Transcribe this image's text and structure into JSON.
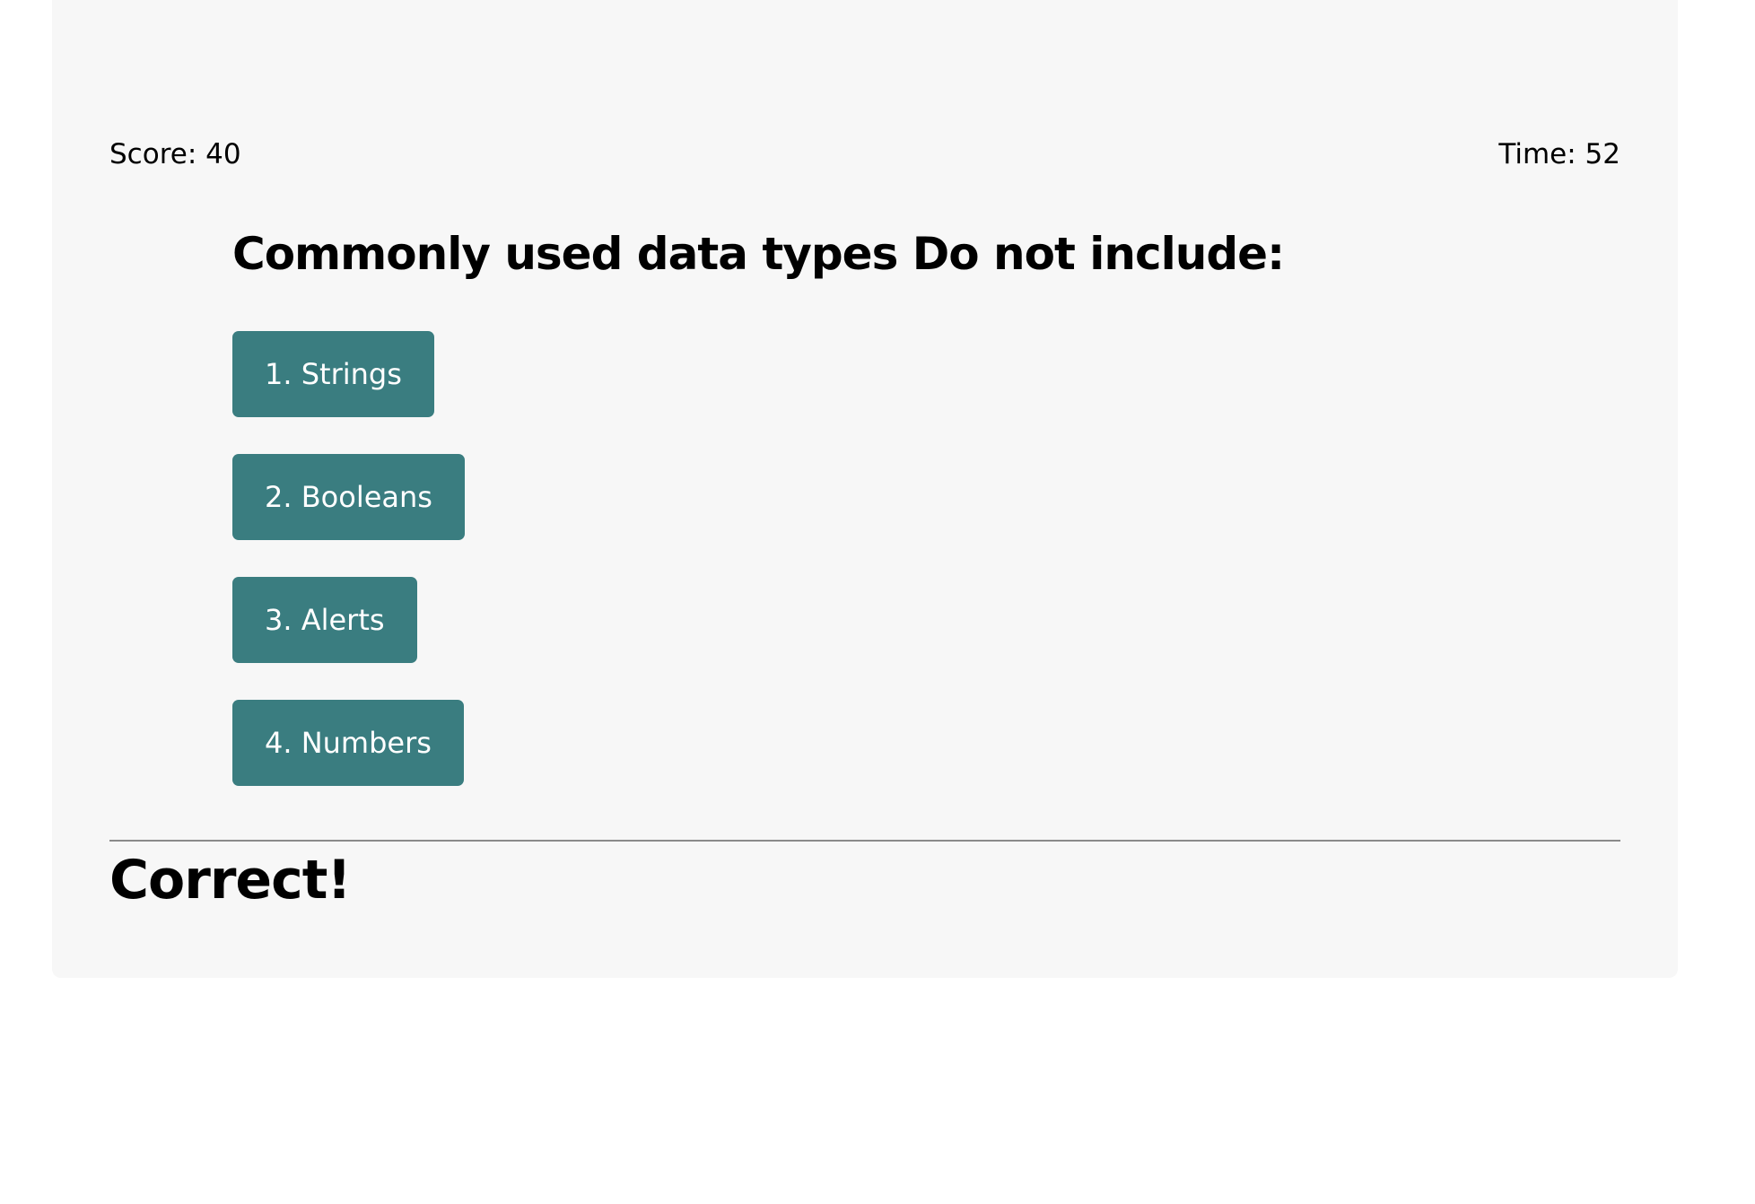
{
  "stats": {
    "score": "Score: 40",
    "time": "Time: 52"
  },
  "question": {
    "title": "Commonly used data types Do not include:",
    "choices": [
      {
        "label": "1. Strings"
      },
      {
        "label": "2. Booleans"
      },
      {
        "label": "3. Alerts"
      },
      {
        "label": "4. Numbers"
      }
    ]
  },
  "feedback": {
    "text": "Correct!"
  },
  "colors": {
    "card_background": "#f7f7f7",
    "button_background": "#3a7d80",
    "button_text": "#ffffff",
    "divider": "#8a8a8a"
  }
}
